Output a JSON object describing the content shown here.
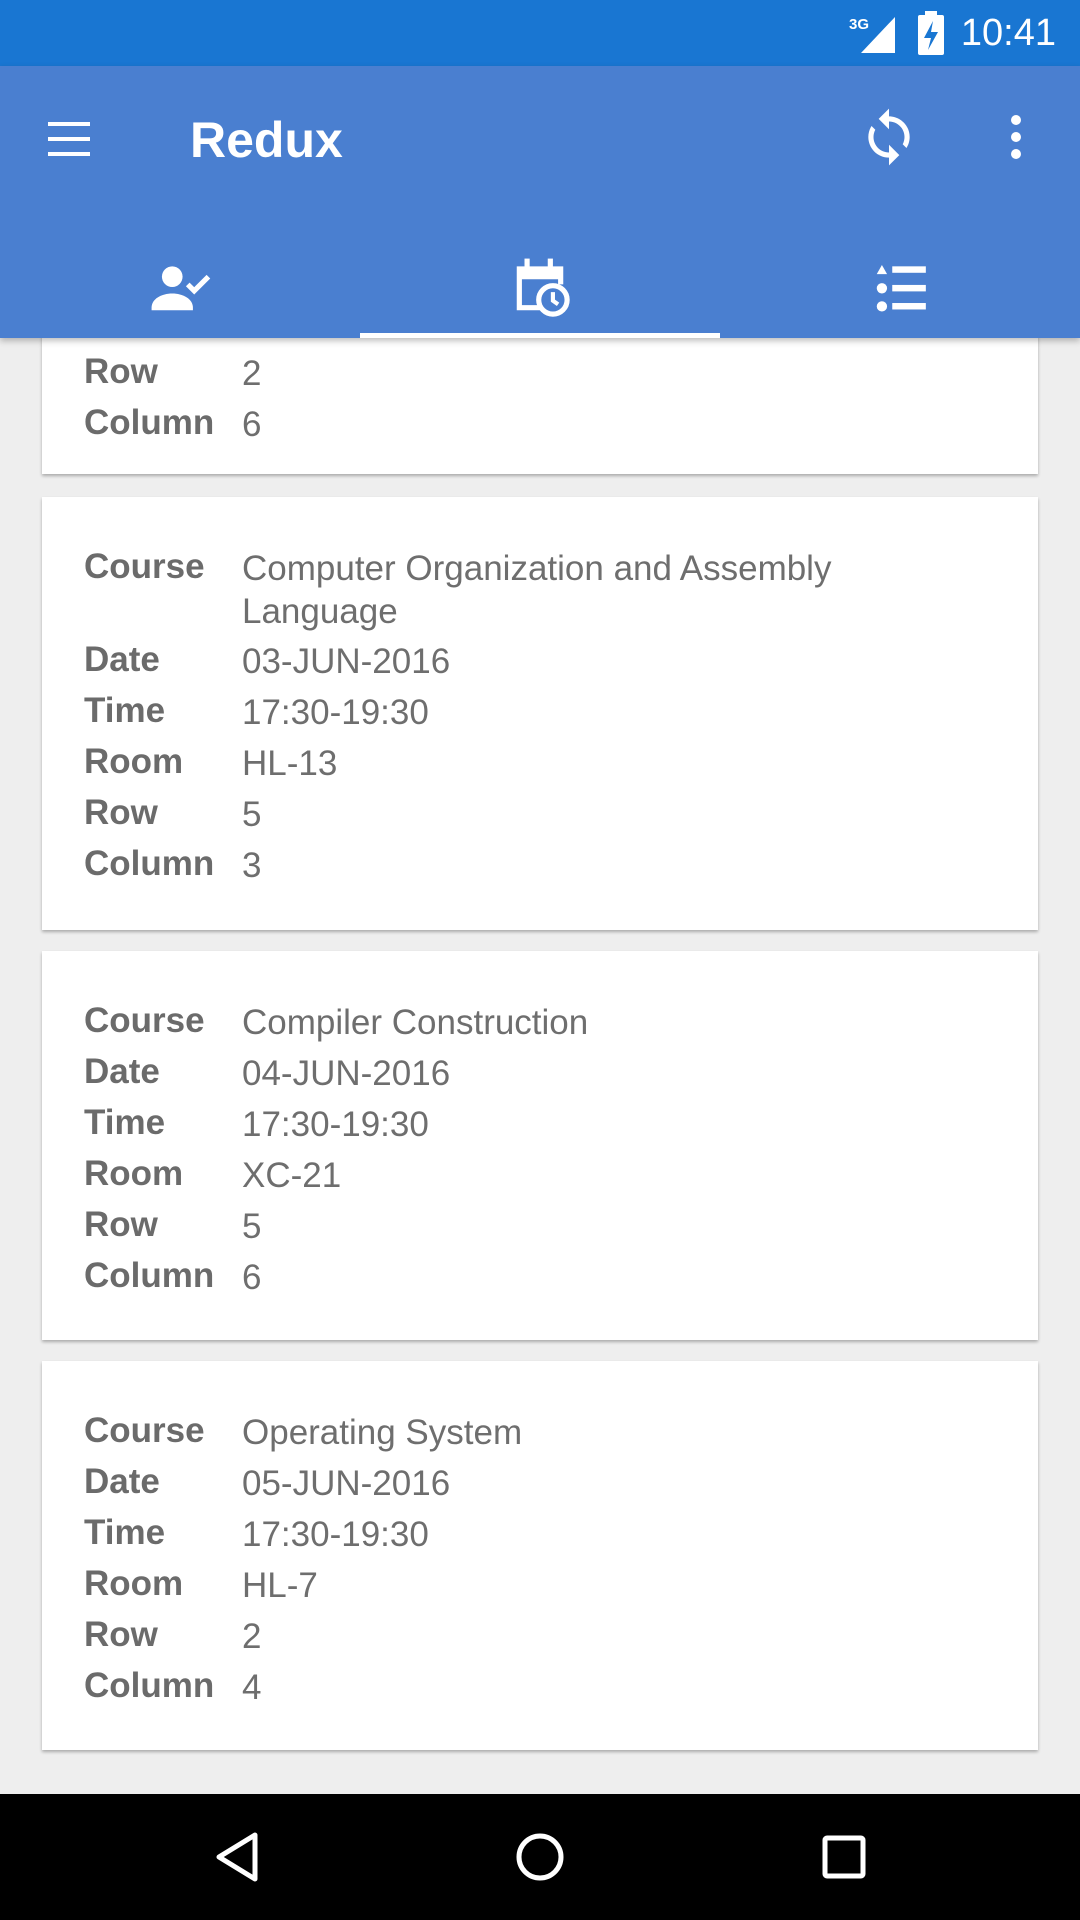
{
  "status_bar": {
    "network": "3G",
    "time": "10:41"
  },
  "app_bar": {
    "title": "Redux",
    "icons": {
      "menu": "menu-icon",
      "sync": "sync-icon",
      "more": "more-vert-icon"
    }
  },
  "tabs": [
    {
      "icon": "person-check-icon",
      "active": false
    },
    {
      "icon": "calendar-clock-icon",
      "active": true
    },
    {
      "icon": "list-icon",
      "active": false
    }
  ],
  "labels": {
    "course": "Course",
    "date": "Date",
    "time": "Time",
    "room": "Room",
    "row": "Row",
    "column": "Column"
  },
  "partial_card": {
    "row": "2",
    "column": "6"
  },
  "exams": [
    {
      "course": "Computer Organization and Assembly Language",
      "date": "03-JUN-2016",
      "time": "17:30-19:30",
      "room": "HL-13",
      "row": "5",
      "column": "3"
    },
    {
      "course": "Compiler Construction",
      "date": "04-JUN-2016",
      "time": "17:30-19:30",
      "room": "XC-21",
      "row": "5",
      "column": "6"
    },
    {
      "course": "Operating System",
      "date": "05-JUN-2016",
      "time": "17:30-19:30",
      "room": "HL-7",
      "row": "2",
      "column": "4"
    }
  ],
  "colors": {
    "status_bar": "#1976d2",
    "app_bar": "#4a7fd0",
    "background": "#eeeeee"
  }
}
